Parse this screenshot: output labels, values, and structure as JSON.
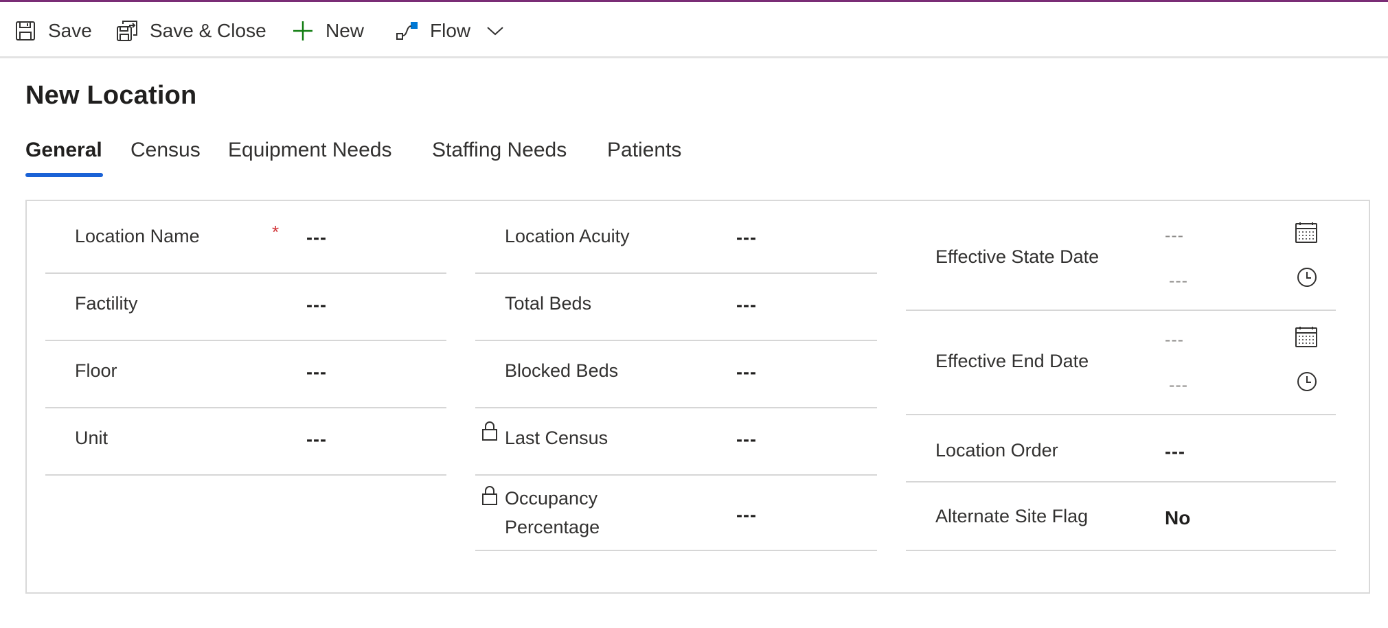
{
  "colors": {
    "accent_top": "#7a2d76",
    "tab_underline": "#1a62d6",
    "required": "#d13438",
    "new_icon": "#107c10",
    "flow_icon": "#0078d4"
  },
  "toolbar": {
    "save_label": "Save",
    "save_icon": "save-icon",
    "save_close_label": "Save & Close",
    "save_close_icon": "save-close-icon",
    "new_label": "New",
    "new_icon": "plus-icon",
    "flow_label": "Flow",
    "flow_icon": "flow-icon",
    "more_icon": "chevron-down-icon"
  },
  "page": {
    "title": "New Location"
  },
  "tabs": [
    {
      "label": "General",
      "active": true
    },
    {
      "label": "Census",
      "active": false
    },
    {
      "label": "Equipment Needs",
      "active": false
    },
    {
      "label": "Staffing Needs",
      "active": false
    },
    {
      "label": "Patients",
      "active": false
    }
  ],
  "form": {
    "column1": [
      {
        "label": "Location Name",
        "value": "---",
        "required_mark": "*"
      },
      {
        "label": "Factility",
        "value": "---"
      },
      {
        "label": "Floor",
        "value": "---"
      },
      {
        "label": "Unit",
        "value": "---"
      }
    ],
    "column2": [
      {
        "label": "Location Acuity",
        "value": "---"
      },
      {
        "label": "Total Beds",
        "value": "---"
      },
      {
        "label": "Blocked Beds",
        "value": "---"
      },
      {
        "label": "Last Census",
        "value": "---",
        "locked": true
      },
      {
        "label_line1": "Occupancy",
        "label_line2": "Percentage",
        "value": "---",
        "locked": true
      }
    ],
    "column3": {
      "effective_state_date": {
        "label": "Effective State Date",
        "date_value": "---",
        "time_value": "---"
      },
      "effective_end_date": {
        "label": "Effective End Date",
        "date_value": "---",
        "time_value": "---"
      },
      "location_order": {
        "label": "Location Order",
        "value": "---"
      },
      "alternate_site_flag": {
        "label": "Alternate Site Flag",
        "value": "No"
      }
    }
  }
}
